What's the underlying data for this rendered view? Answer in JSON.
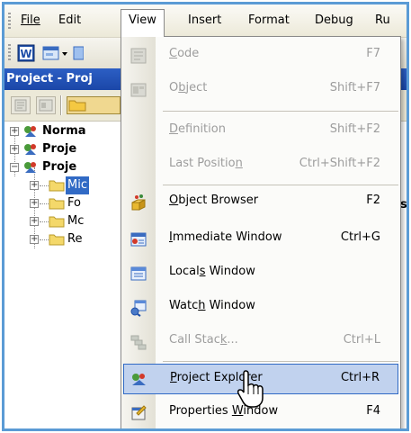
{
  "menubar": {
    "items": [
      "File",
      "Edit",
      "View",
      "Insert",
      "Format",
      "Debug",
      "Ru"
    ]
  },
  "project_window": {
    "title": "Project - Proj"
  },
  "tree": {
    "rows": [
      "Norma",
      "Proje",
      "Proje",
      "Mic",
      "Fo",
      "Mc",
      "Re"
    ]
  },
  "peek_text": "s",
  "view_menu": {
    "items": [
      {
        "pre": "",
        "ul": "C",
        "post": "ode",
        "shortcut": "F7",
        "disabled": true,
        "icon": "code-icon"
      },
      {
        "pre": "O",
        "ul": "b",
        "post": "ject",
        "shortcut": "Shift+F7",
        "disabled": true,
        "icon": "object-icon"
      },
      {
        "pre": "",
        "ul": "D",
        "post": "efinition",
        "shortcut": "Shift+F2",
        "disabled": true,
        "icon": ""
      },
      {
        "pre": "Last Positio",
        "ul": "n",
        "post": "",
        "shortcut": "Ctrl+Shift+F2",
        "disabled": true,
        "icon": ""
      },
      {
        "pre": "",
        "ul": "O",
        "post": "bject Browser",
        "shortcut": "F2",
        "disabled": false,
        "icon": "object-browser-icon"
      },
      {
        "pre": "",
        "ul": "I",
        "post": "mmediate Window",
        "shortcut": "Ctrl+G",
        "disabled": false,
        "icon": "immediate-window-icon"
      },
      {
        "pre": "Local",
        "ul": "s",
        "post": " Window",
        "shortcut": "",
        "disabled": false,
        "icon": "locals-window-icon"
      },
      {
        "pre": "Watc",
        "ul": "h",
        "post": " Window",
        "shortcut": "",
        "disabled": false,
        "icon": "watch-window-icon"
      },
      {
        "pre": "Call Stac",
        "ul": "k",
        "post": "...",
        "shortcut": "Ctrl+L",
        "disabled": true,
        "icon": "call-stack-icon"
      },
      {
        "pre": "",
        "ul": "P",
        "post": "roject Explorer",
        "shortcut": "Ctrl+R",
        "disabled": false,
        "icon": "project-explorer-icon"
      },
      {
        "pre": "Properties ",
        "ul": "W",
        "post": "indow",
        "shortcut": "F4",
        "disabled": false,
        "icon": "properties-window-icon"
      }
    ]
  },
  "colors": {
    "accent": "#316ac5",
    "hover": "#c1d2ee",
    "title_bar": "#1b47a8",
    "frame": "#5b9bd5",
    "disabled_text": "#9d9d9d"
  }
}
